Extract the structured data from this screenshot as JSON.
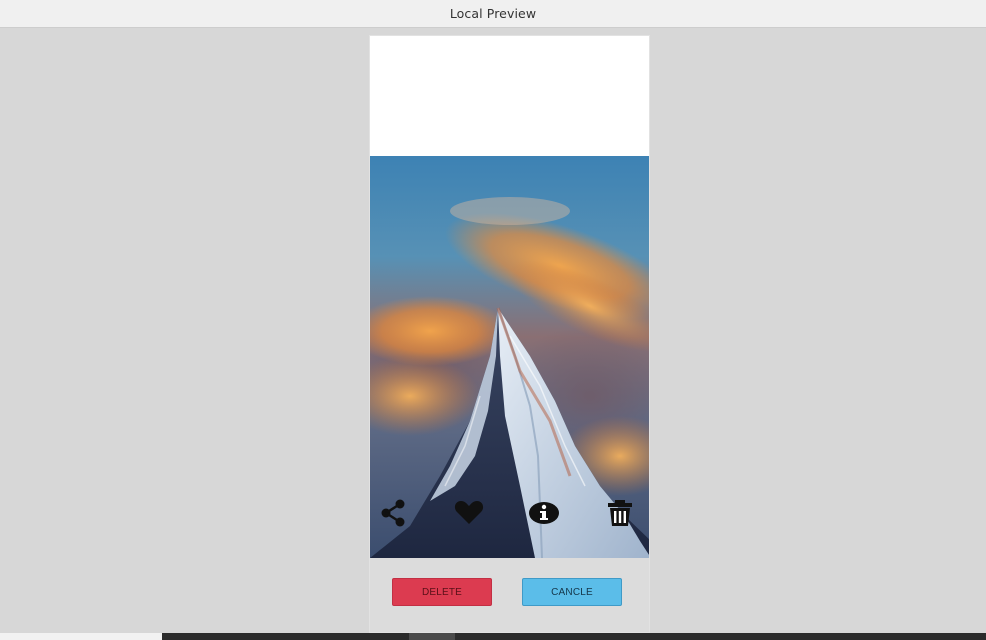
{
  "window": {
    "title": "Local Preview"
  },
  "actions": {
    "share": "share-icon",
    "like": "heart-icon",
    "info": "info-icon",
    "delete": "trash-icon"
  },
  "buttons": {
    "delete_label": "DELETE",
    "cancel_label": "CANCLE"
  },
  "colors": {
    "delete_button": "#dc3b50",
    "cancel_button": "#5bbde9",
    "background": "#d7d7d7"
  }
}
